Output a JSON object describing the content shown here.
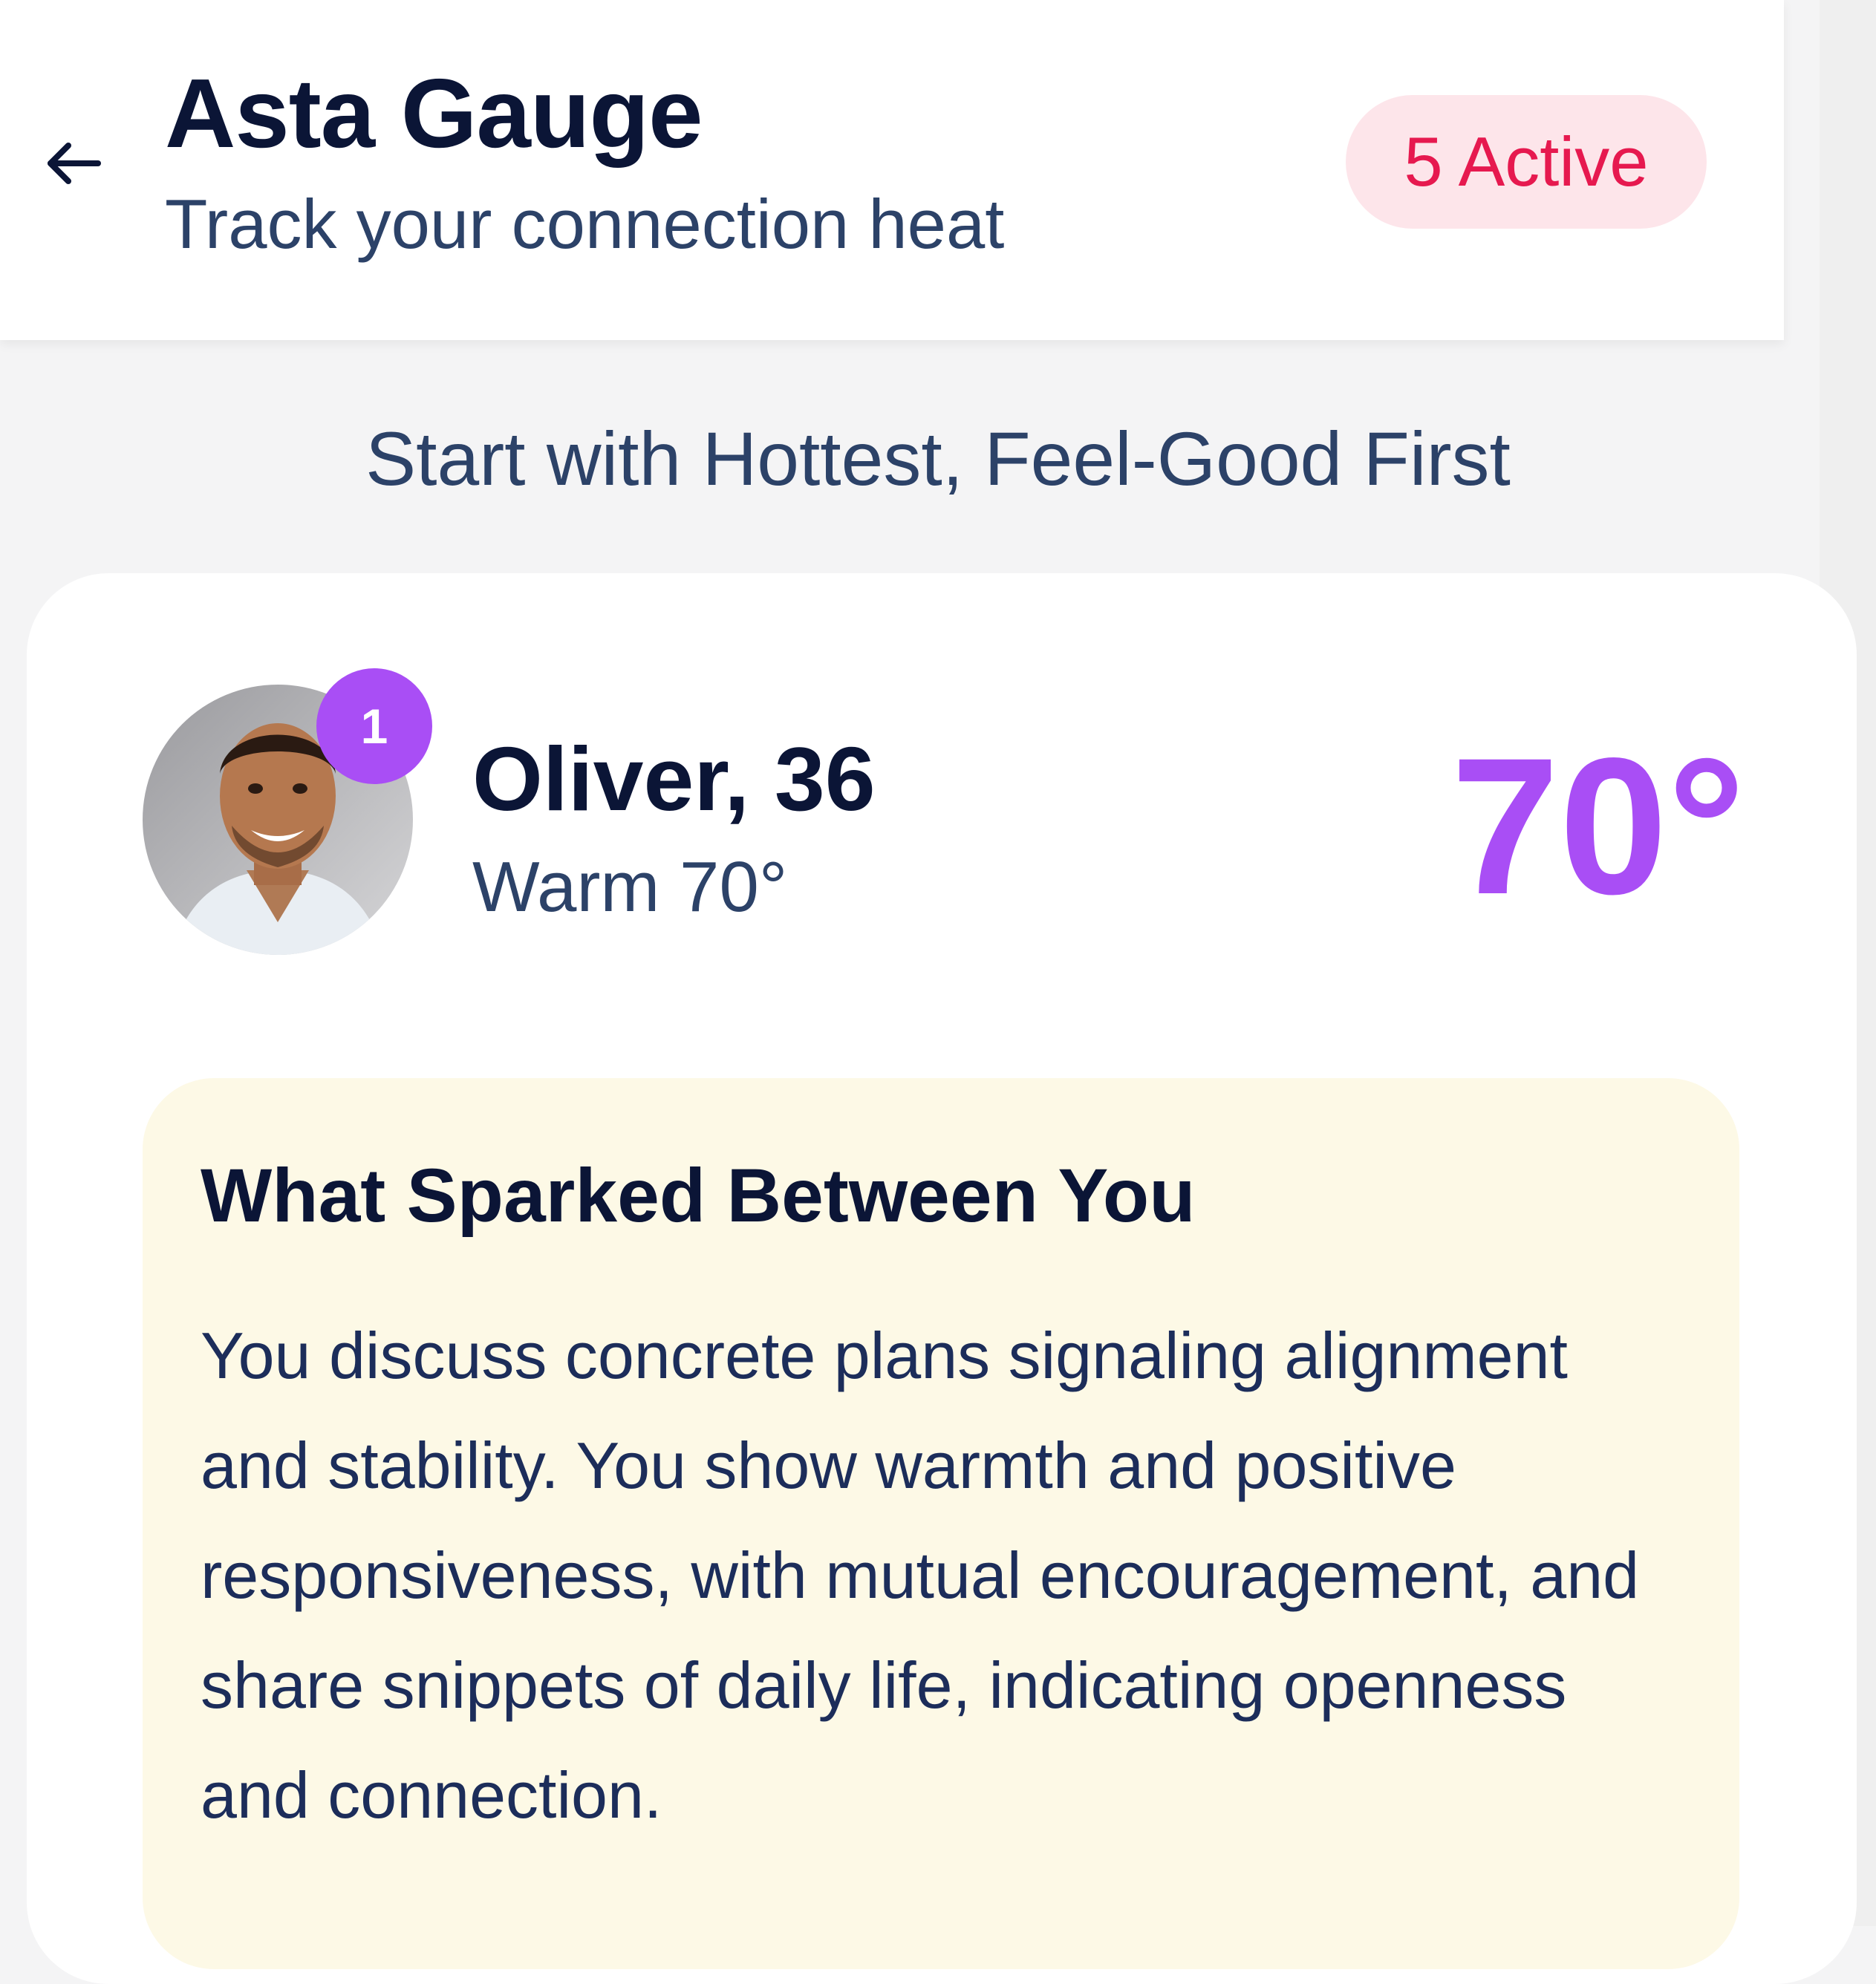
{
  "header": {
    "title": "Asta Gauge",
    "subtitle": "Track your connection heat",
    "active_badge": "5 Active",
    "back_icon": "arrow-left-icon"
  },
  "section": {
    "heading": "Start with Hottest, Feel-Good First"
  },
  "match_card": {
    "rank": "1",
    "name": "Oliver, 36",
    "temperature_label": "Warm 70°",
    "temperature_value": "70°",
    "avatar_icon": "profile-photo",
    "spark": {
      "title": "What Sparked Between You",
      "body": "You discuss concrete plans signaling alignment and stability. You show warmth and positive responsiveness, with mutual encouragement, and share snippets of daily life, indicating openness and connection."
    }
  },
  "colors": {
    "accent_purple": "#a94ef5",
    "badge_pink_text": "#e6194f",
    "badge_pink_bg": "#fde5ea",
    "spark_bg": "#fdf9e6",
    "title_navy": "#0b1536",
    "subtitle_blue": "#2c4268"
  }
}
